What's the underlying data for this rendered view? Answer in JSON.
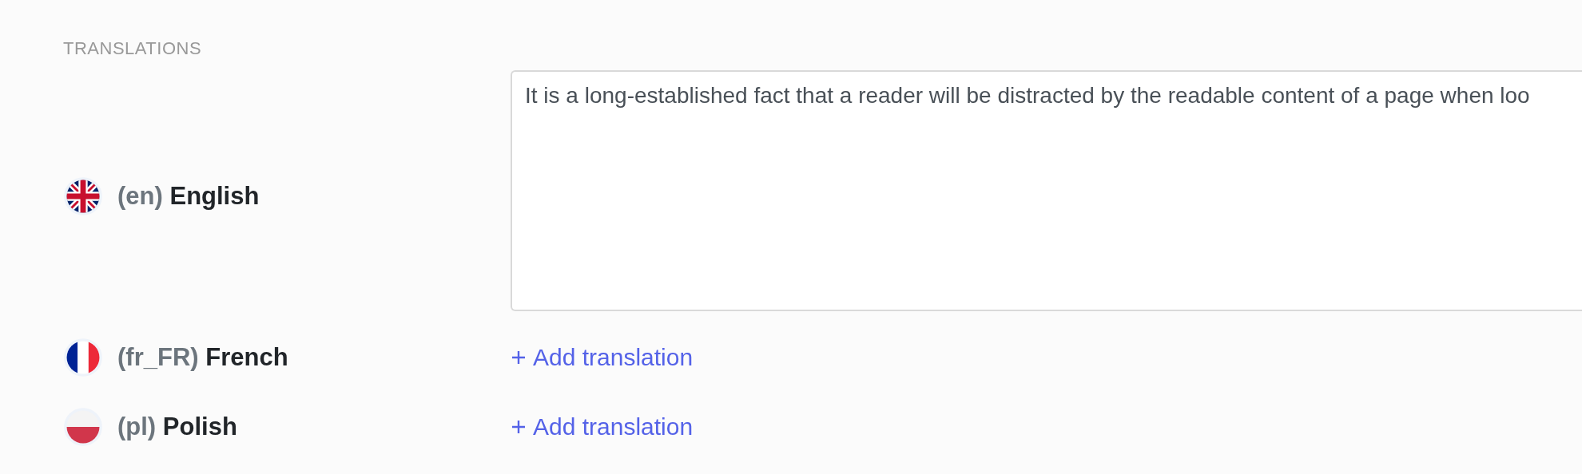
{
  "section_title": "TRANSLATIONS",
  "languages": [
    {
      "kind": "text",
      "flag": {
        "kind": "uk"
      },
      "code": "(en)",
      "name": "English",
      "value": "It is a long-established fact that a reader will be distracted by the readable content of a page when loo"
    },
    {
      "kind": "add",
      "flag": {
        "kind": "fr"
      },
      "code": "(fr_FR)",
      "name": "French",
      "action": "Add translation"
    },
    {
      "kind": "add",
      "flag": {
        "kind": "pl"
      },
      "code": "(pl)",
      "name": "Polish",
      "action": "Add translation"
    }
  ]
}
